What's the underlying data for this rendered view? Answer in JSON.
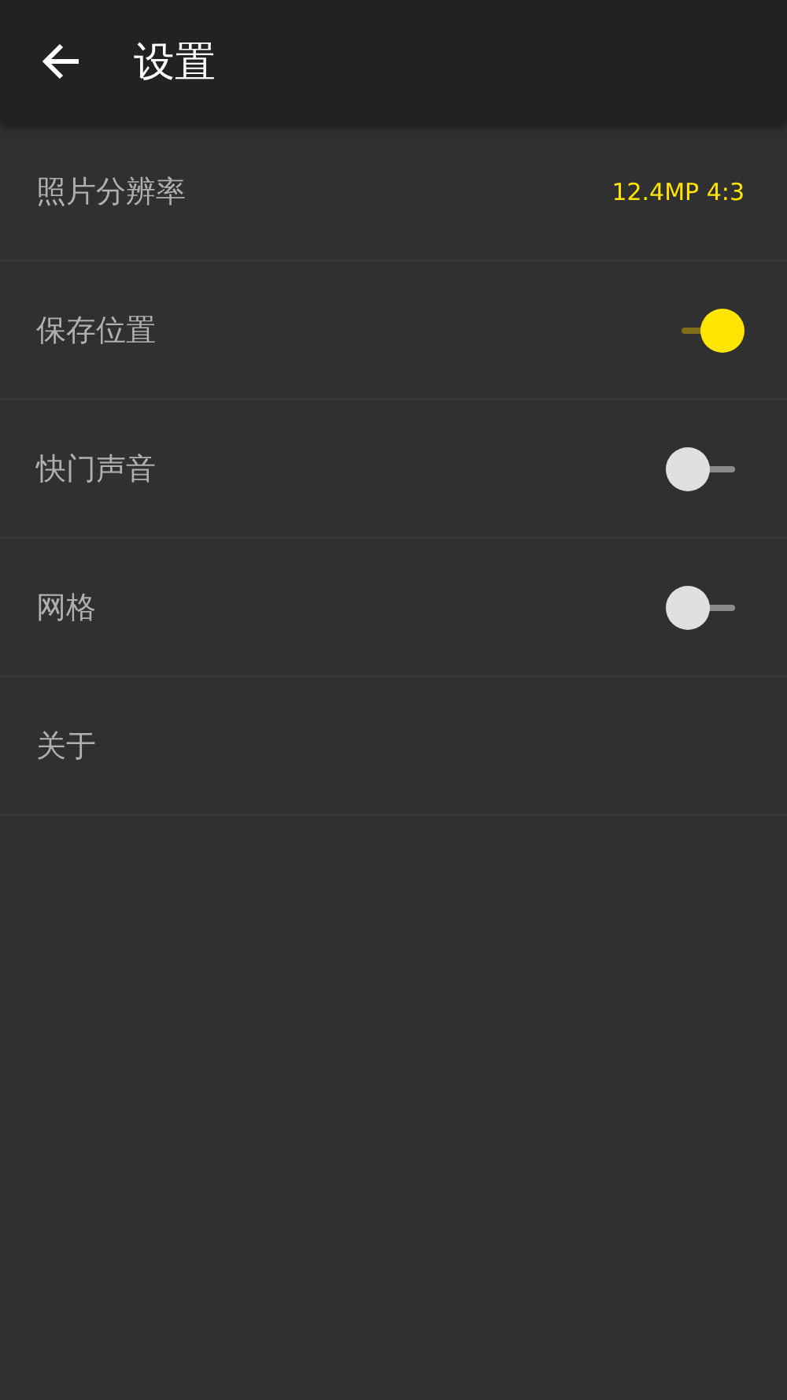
{
  "header": {
    "title": "设置"
  },
  "settings": [
    {
      "kind": "value",
      "label": "照片分辨率",
      "value": "12.4MP 4:3"
    },
    {
      "kind": "switch",
      "label": "保存位置",
      "on": true
    },
    {
      "kind": "switch",
      "label": "快门声音",
      "on": false
    },
    {
      "kind": "switch",
      "label": "网格",
      "on": false
    },
    {
      "kind": "link",
      "label": "关于"
    }
  ]
}
